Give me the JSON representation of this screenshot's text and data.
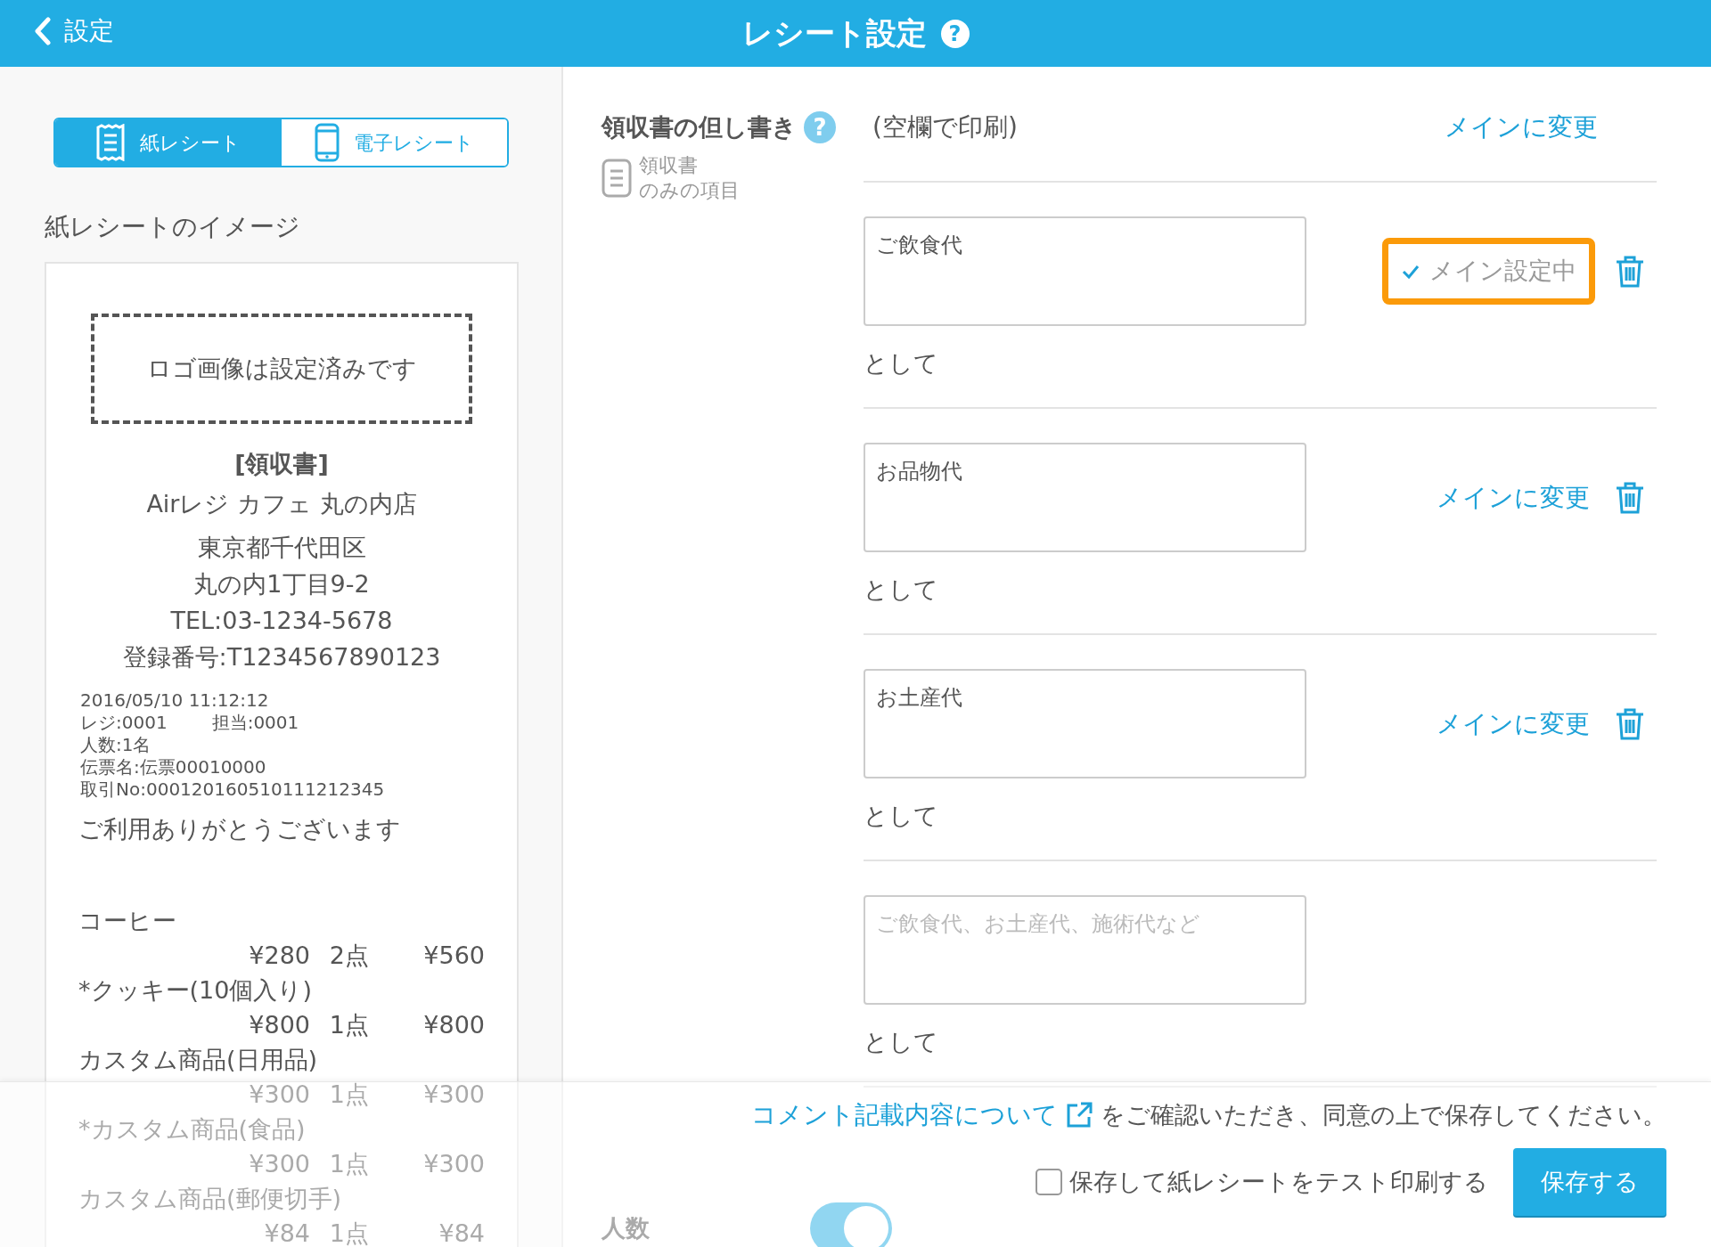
{
  "header": {
    "back_label": "設定",
    "title": "レシート設定",
    "help_mark": "?"
  },
  "receipt_tabs": [
    {
      "label": "紙レシート",
      "kind": "receipt",
      "selected": true
    },
    {
      "label": "電子レシート",
      "kind": "phone",
      "selected": false
    }
  ],
  "preview": {
    "heading": "紙レシートのイメージ",
    "logo_note": "ロゴ画像は設定済みです",
    "title": "[領収書]",
    "store": "Airレジ カフェ 丸の内店",
    "address_lines": [
      "東京都千代田区",
      "丸の内1丁目9-2",
      "TEL:03-1234-5678",
      "登録番号:T1234567890123"
    ],
    "details": [
      [
        "2016/05/10 11:12:12"
      ],
      [
        "レジ:0001",
        "担当:0001"
      ],
      [
        "人数:1名"
      ],
      [
        "伝票名:伝票00010000"
      ],
      [
        "取引No:000120160510111212345"
      ]
    ],
    "thanks": "ご利用ありがとうございます",
    "items": [
      {
        "name": "コーヒー",
        "price": "¥280",
        "qty": "2点",
        "total": "¥560"
      },
      {
        "name": "*クッキー(10個入り)",
        "price": "¥800",
        "qty": "1点",
        "total": "¥800"
      },
      {
        "name": "カスタム商品(日用品)",
        "price": "¥300",
        "qty": "1点",
        "total": "¥300"
      },
      {
        "name": "*カスタム商品(食品)",
        "price": "¥300",
        "qty": "1点",
        "total": "¥300"
      },
      {
        "name": "カスタム商品(郵便切手)",
        "price": "¥84",
        "qty": "1点",
        "total": "¥84"
      }
    ]
  },
  "section": {
    "label": "領収書の但し書き",
    "help_mark": "?",
    "note_lines": [
      "領収書",
      "のみの項目"
    ],
    "blank_option": {
      "label": "(空欄で印刷)",
      "main": false,
      "action": "メインに変更"
    },
    "options": [
      {
        "value": "ご飲食代",
        "main": true,
        "highlighted": true,
        "status": "メイン設定中",
        "suffix": "として",
        "deletable": true
      },
      {
        "value": "お品物代",
        "main": false,
        "highlighted": false,
        "action": "メインに変更",
        "suffix": "として",
        "deletable": true
      },
      {
        "value": "お土産代",
        "main": false,
        "highlighted": false,
        "action": "メインに変更",
        "suffix": "として",
        "deletable": true
      },
      {
        "placeholder": "ご飲食代、お土産代、施術代など",
        "main": false,
        "highlighted": false,
        "suffix": "として",
        "deletable": false
      }
    ]
  },
  "guests_row": {
    "label": "人数",
    "on": true
  },
  "footer": {
    "link": "コメント記載内容について",
    "notice": "をご確認いただき、同意の上で保存してください。",
    "test_print": {
      "label": "保存して紙レシートをテスト印刷する",
      "checked": false
    },
    "save_button": "保存する"
  }
}
